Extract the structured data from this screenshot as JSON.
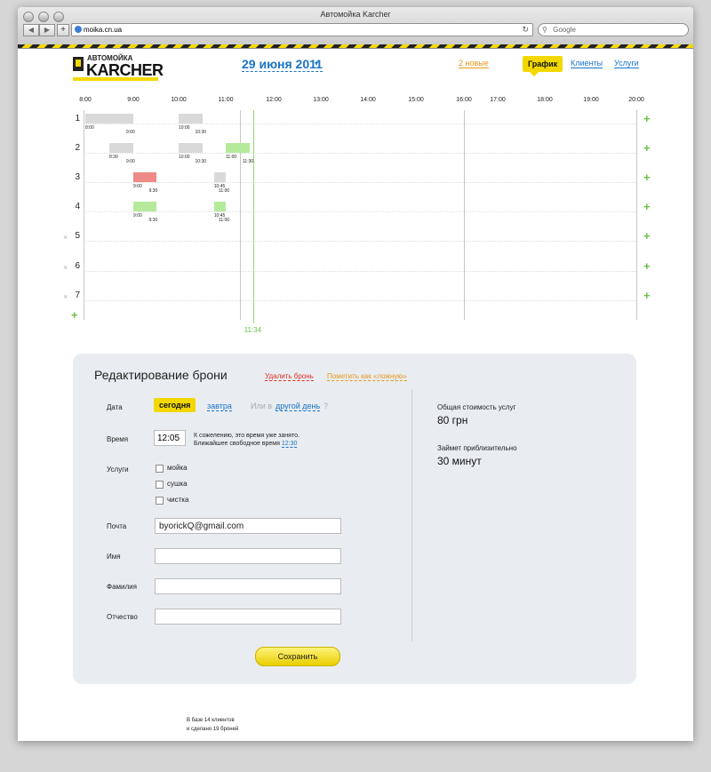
{
  "window": {
    "title": "Автомойка Karcher",
    "url": "moika.cn.ua",
    "search_placeholder": "Google"
  },
  "brand": {
    "small": "АВТОМОЙКА",
    "big": "KARCHER",
    "colors": {
      "yellow": "#f3d800",
      "blue": "#1a73c8",
      "green": "#6cc04a",
      "red": "#e0302a",
      "orange": "#e8961c"
    }
  },
  "header": {
    "date": "29 июня 2011",
    "new_count": "2 новые"
  },
  "nav": {
    "active": "График",
    "items": [
      "Клиенты",
      "Услуги"
    ]
  },
  "schedule": {
    "times": [
      "8:00",
      "9:00",
      "10:00",
      "11:00",
      "12:00",
      "13:00",
      "14:00",
      "15:00",
      "16:00",
      "17:00",
      "18:00",
      "19:00",
      "20:00"
    ],
    "rows": [
      {
        "num": "1",
        "removable": false
      },
      {
        "num": "2",
        "removable": false
      },
      {
        "num": "3",
        "removable": false
      },
      {
        "num": "4",
        "removable": false
      },
      {
        "num": "5",
        "removable": true
      },
      {
        "num": "6",
        "removable": true
      },
      {
        "num": "7",
        "removable": true
      }
    ],
    "remove_symbol": "×",
    "add_symbol": "+",
    "current_time": "11:34",
    "bookings": [
      {
        "row": 1,
        "start": "8:00",
        "end": "9:00",
        "status": "busy"
      },
      {
        "row": 1,
        "start": "10:00",
        "end": "10:30",
        "status": "busy"
      },
      {
        "row": 2,
        "start": "8:30",
        "end": "9:00",
        "status": "busy"
      },
      {
        "row": 2,
        "start": "10:00",
        "end": "10:30",
        "status": "busy"
      },
      {
        "row": 2,
        "start": "11:00",
        "end": "11:30",
        "status": "ok"
      },
      {
        "row": 3,
        "start": "9:00",
        "end": "9:30",
        "status": "warn"
      },
      {
        "row": 3,
        "start": "10:45",
        "end": "11:00",
        "status": "busy"
      },
      {
        "row": 4,
        "start": "9:00",
        "end": "9:30",
        "status": "ok"
      },
      {
        "row": 4,
        "start": "10:45",
        "end": "11:00",
        "status": "ok"
      }
    ]
  },
  "form": {
    "title": "Редактирование брони",
    "delete": "Удалить бронь",
    "mark_false": "Пометить как «ложную»",
    "date_label": "Дата",
    "today": "сегодня",
    "tomorrow": "завтра",
    "or_in": "Или в",
    "other_day": "другой день",
    "question": "?",
    "time_label": "Время",
    "time_value": "12:05",
    "busy_msg_1": "К сожелению, это время уже занято.",
    "busy_msg_2": "Ближайшее свободное время",
    "free_time": "12:30",
    "services_label": "Услуги",
    "services": [
      "мойка",
      "сушка",
      "чистка"
    ],
    "email_label": "Почта",
    "email_value": "byorickQ@gmail.com",
    "name_label": "Имя",
    "name_value": "",
    "surname_label": "Фамилия",
    "surname_value": "",
    "patronymic_label": "Отчество",
    "patronymic_value": "",
    "save": "Сохранить",
    "total_label": "Общая стоимость услуг",
    "total_value": "80 грн",
    "duration_label": "Займет приблизительно",
    "duration_value": "30 минут"
  },
  "footer": {
    "line1": "В базе 14 клиентов",
    "line2": "и сделано 19 броней"
  }
}
